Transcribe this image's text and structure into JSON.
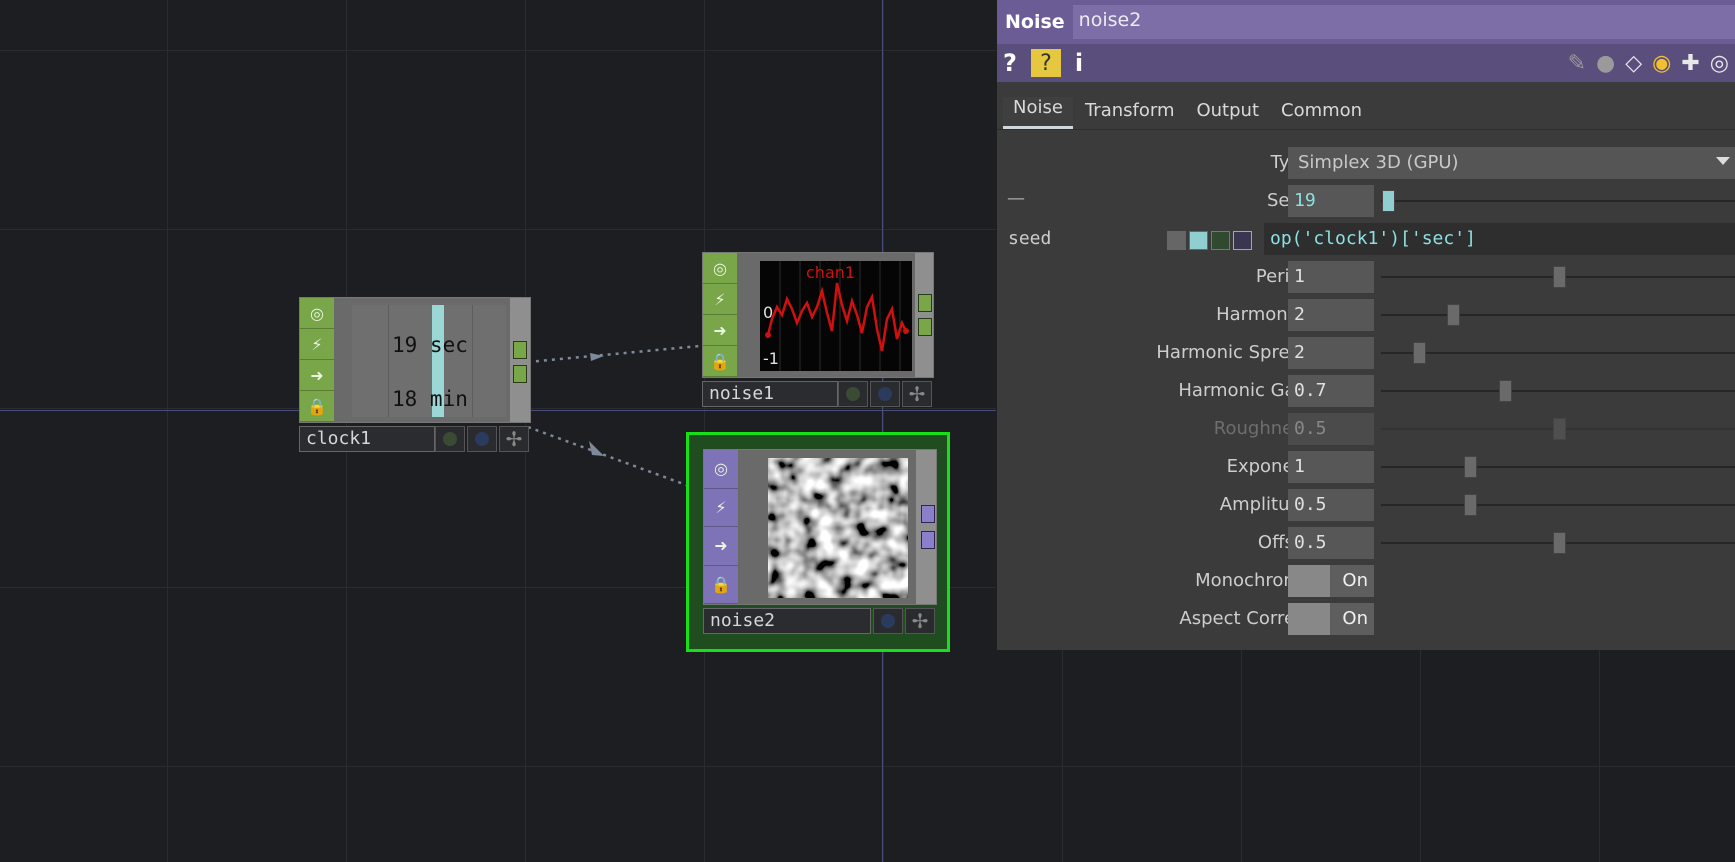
{
  "network": {
    "clock1": {
      "name": "clock1",
      "line1": "19 sec",
      "line2": "18 min"
    },
    "noise1": {
      "name": "noise1",
      "chart_label": "chan1",
      "y_top": "0",
      "y_bottom": "-1"
    },
    "noise2": {
      "name": "noise2"
    }
  },
  "panel": {
    "op_type": "Noise",
    "op_name": "noise2",
    "toolbar": {
      "help": "?",
      "help_py": "?",
      "info": "i"
    },
    "tabs": [
      "Noise",
      "Transform",
      "Output",
      "Common"
    ],
    "params": {
      "type": {
        "label": "Type",
        "value": "Simplex 3D (GPU)"
      },
      "seed": {
        "label": "Seed",
        "value": "19",
        "collapse": "—"
      },
      "seed_expr": {
        "label": "seed",
        "value": "op('clock1')['sec']"
      },
      "period": {
        "label": "Period",
        "value": "1"
      },
      "harmonics": {
        "label": "Harmonics",
        "value": "2"
      },
      "harmonic_spread": {
        "label": "Harmonic Spread",
        "value": "2"
      },
      "harmonic_gain": {
        "label": "Harmonic Gain",
        "value": "0.7"
      },
      "roughness": {
        "label": "Roughness",
        "value": "0.5"
      },
      "exponent": {
        "label": "Exponent",
        "value": "1"
      },
      "amplitude": {
        "label": "Amplitude",
        "value": "0.5"
      },
      "offset": {
        "label": "Offset",
        "value": "0.5"
      },
      "monochrome": {
        "label": "Monochrome",
        "value": "On"
      },
      "aspect_correct": {
        "label": "Aspect Correct",
        "value": "On"
      }
    }
  },
  "colors": {
    "chop": "#7aa64a",
    "top": "#8a7fc8",
    "selected": "#18e018",
    "header": "#6c5c95",
    "expr": "#8de0e0"
  }
}
